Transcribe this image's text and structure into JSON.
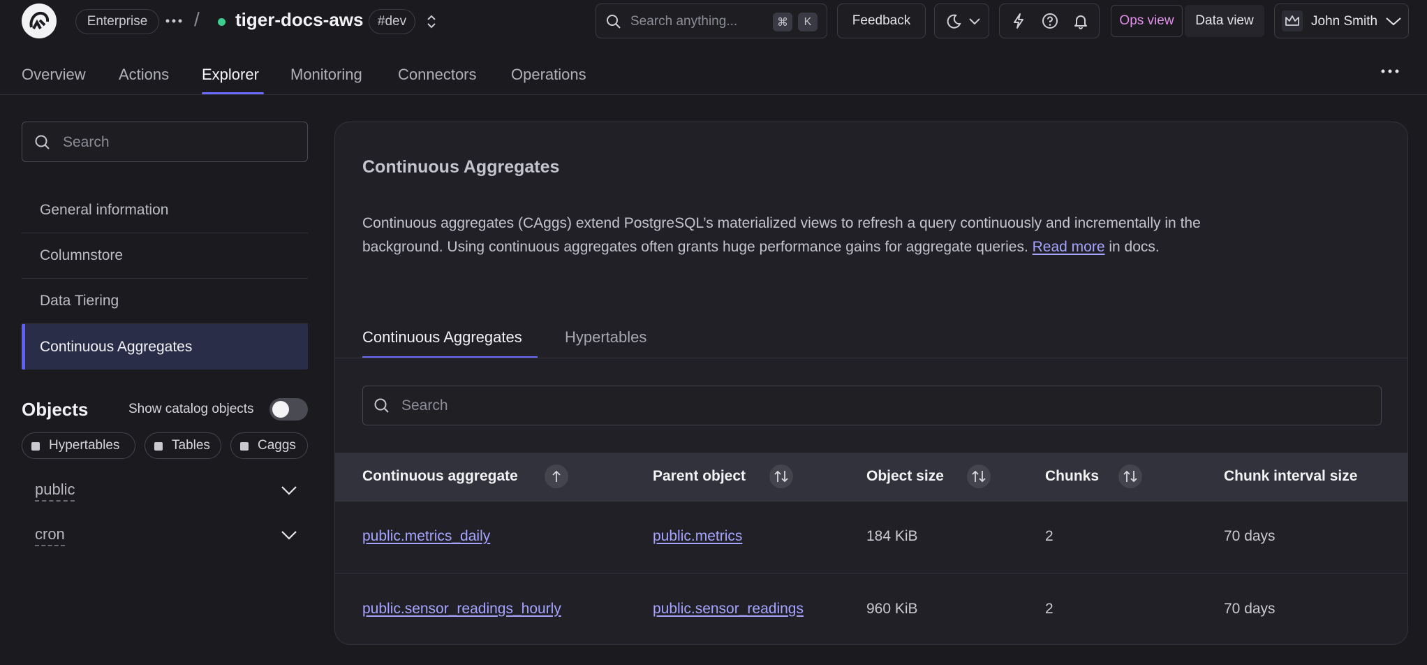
{
  "header": {
    "org_label": "Enterprise",
    "project_name": "tiger-docs-aws",
    "env_tag": "#dev",
    "search_placeholder": "Search anything...",
    "shortcut_keys": [
      "⌘",
      "K"
    ],
    "feedback_label": "Feedback",
    "ops_view_label": "Ops view",
    "data_view_label": "Data view",
    "user_name": "John Smith"
  },
  "nav": {
    "tabs": [
      "Overview",
      "Actions",
      "Explorer",
      "Monitoring",
      "Connectors",
      "Operations"
    ],
    "active": "Explorer"
  },
  "sidebar": {
    "search_placeholder": "Search",
    "items": [
      "General information",
      "Columnstore",
      "Data Tiering",
      "Continuous Aggregates"
    ],
    "active": "Continuous Aggregates",
    "objects_title": "Objects",
    "show_catalog_label": "Show catalog objects",
    "show_catalog_enabled": false,
    "filters": [
      "Hypertables",
      "Tables",
      "Caggs"
    ],
    "schemas": [
      "public",
      "cron"
    ]
  },
  "main": {
    "title": "Continuous Aggregates",
    "description_prefix": "Continuous aggregates (CAggs) extend PostgreSQL’s materialized views to refresh a query continuously and incrementally in the background. Using continuous aggregates often grants huge performance gains for aggregate queries.",
    "read_more_label": "Read more",
    "description_suffix": "in docs.",
    "tabs": [
      "Continuous Aggregates",
      "Hypertables"
    ],
    "active_tab": "Continuous Aggregates",
    "table_search_placeholder": "Search",
    "table": {
      "columns": [
        "Continuous aggregate",
        "Parent object",
        "Object size",
        "Chunks",
        "Chunk interval size"
      ],
      "rows": [
        [
          "public.metrics_daily",
          "public.metrics",
          "184 KiB",
          "2",
          "70 days"
        ],
        [
          "public.sensor_readings_hourly",
          "public.sensor_readings",
          "960 KiB",
          "2",
          "70 days"
        ]
      ]
    }
  },
  "colors": {
    "accent": "#6b6bff",
    "link": "#a7a4ff",
    "status_dot": "#3ccf91",
    "ops_view": "#e08ee8"
  },
  "icons": [
    "tiger-logo-icon",
    "ellipsis-icon",
    "chevron-up-down-icon",
    "search-icon",
    "moon-icon",
    "chevron-down-icon",
    "lightning-icon",
    "help-icon",
    "bell-icon",
    "crown-icon",
    "more-icon",
    "sort-asc-icon",
    "sort-icon"
  ]
}
